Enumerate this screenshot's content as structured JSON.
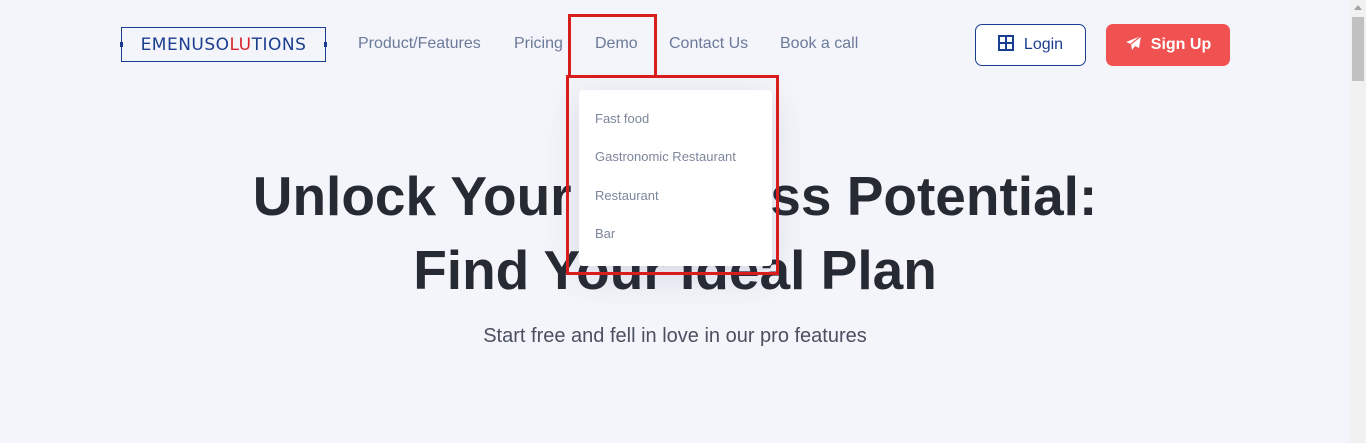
{
  "header": {
    "logo_text_a": "EMENUSO",
    "logo_text_accent": "LU",
    "logo_text_b": "TIONS",
    "nav": {
      "product": "Product/Features",
      "pricing": "Pricing",
      "demo": "Demo",
      "contact": "Contact Us",
      "book": "Book a call"
    },
    "login_label": "Login",
    "signup_label": "Sign Up"
  },
  "hero": {
    "title_line1": "Unlock Your Business Potential:",
    "title_line2": "Find Your Ideal Plan",
    "subtitle": "Start free and fell in love in our pro features"
  },
  "demo_dropdown": {
    "items": [
      "Fast food",
      "Gastronomic Restaurant",
      "Restaurant",
      "Bar"
    ]
  },
  "colors": {
    "brand": "#1a3d8f",
    "accent": "#f05252",
    "annotation": "#d91c1c"
  },
  "icons": {
    "login": "grid-icon",
    "signup": "paper-plane-icon"
  }
}
